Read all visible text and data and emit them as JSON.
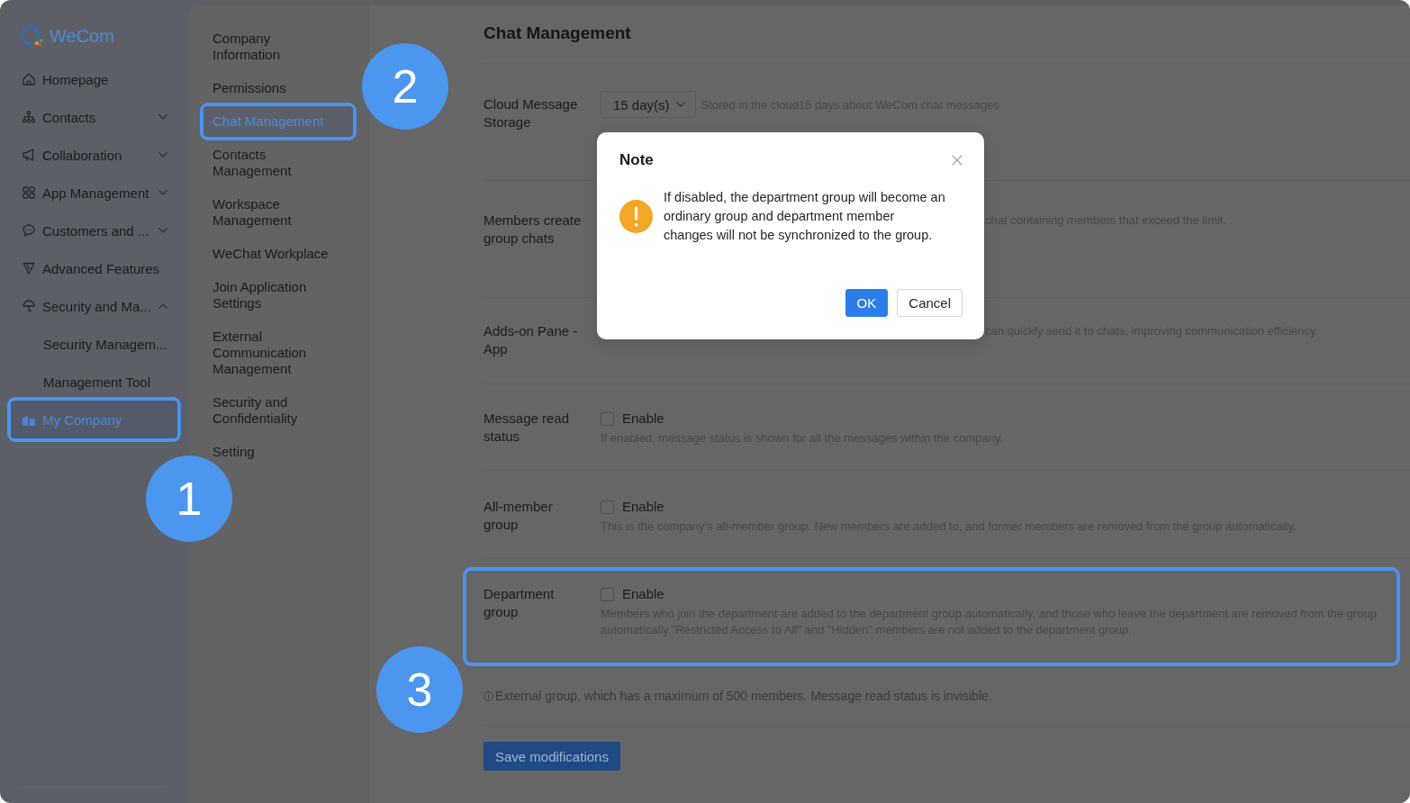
{
  "brand": {
    "name": "WeCom"
  },
  "sidebar": {
    "items": [
      {
        "label": "Homepage",
        "selected": false,
        "highlighted": false
      },
      {
        "label": "Contacts",
        "selected": false,
        "expanded": false,
        "highlighted": false
      },
      {
        "label": "Collaboration",
        "selected": false,
        "expanded": false,
        "highlighted": false
      },
      {
        "label": "App Management",
        "selected": false,
        "expanded": false,
        "highlighted": false
      },
      {
        "label": "Customers and ...",
        "selected": false,
        "expanded": false,
        "highlighted": false
      },
      {
        "label": "Advanced Features",
        "selected": false,
        "highlighted": false
      },
      {
        "label": "Security and Ma...",
        "selected": false,
        "expanded": true,
        "highlighted": false,
        "children": [
          {
            "label": "Security Managem...",
            "selected": false,
            "highlighted": false
          },
          {
            "label": "Management Tool",
            "selected": false,
            "highlighted": false
          }
        ]
      },
      {
        "label": "My Company",
        "selected": true,
        "highlighted": true
      }
    ]
  },
  "subnav": {
    "items": [
      {
        "label": "Company Information",
        "selected": false,
        "highlighted": false
      },
      {
        "label": "Permissions",
        "selected": false,
        "highlighted": false
      },
      {
        "label": "Chat Management",
        "selected": true,
        "highlighted": true
      },
      {
        "label": "Contacts Management",
        "selected": false,
        "highlighted": false
      },
      {
        "label": "Workspace Management",
        "selected": false,
        "highlighted": false
      },
      {
        "label": "WeChat Workplace",
        "selected": false,
        "highlighted": false
      },
      {
        "label": "Join Application Settings",
        "selected": false,
        "highlighted": false
      },
      {
        "label": "External Communication Management",
        "selected": false,
        "highlighted": false
      },
      {
        "label": "Security and Confidentiality",
        "selected": false,
        "highlighted": false
      },
      {
        "label": "Setting",
        "selected": false,
        "highlighted": false
      }
    ]
  },
  "main": {
    "title": "Chat Management",
    "rows": [
      {
        "kind": "select",
        "label": "Cloud Message Storage",
        "value": "15 day(s)",
        "description": "Stored in the cloud15 days about WeCom chat messages",
        "highlighted": false
      },
      {
        "kind": "fragment",
        "label": "Members create group chats",
        "description": "chat containing members that exceed the limit.",
        "highlighted": false
      },
      {
        "kind": "fragment",
        "label": "Adds-on Pane - App",
        "description": "can quickly send it to chats, improving communication efficiency.",
        "highlighted": false
      },
      {
        "kind": "checkbox",
        "label": "Message read status",
        "option": "Enable",
        "checked": false,
        "description": "If enabled, message status is shown for all the messages within the company.",
        "highlighted": false
      },
      {
        "kind": "checkbox",
        "label": "All-member group",
        "option": "Enable",
        "checked": false,
        "description": "This is the company’s all-member group. New members are added to, and former members are removed from the group automatically.",
        "highlighted": false
      },
      {
        "kind": "checkbox",
        "label": "Department group",
        "option": "Enable",
        "checked": false,
        "description": "Members who join the department are added to the department group automatically, and those who leave the department are removed from the group automatically.\"Restricted Access to All\" and \"Hidden\" members are not added to the department group.",
        "highlighted": true
      }
    ],
    "note": "External group, which has a maximum of 500 members. Message read status is invisible.",
    "save_button": "Save modifications"
  },
  "dialog": {
    "title": "Note",
    "message": "If disabled, the department group will become an ordinary group and department member changes will not be synchronized to the group.",
    "buttons": [
      {
        "label": "OK",
        "kind": "primary"
      },
      {
        "label": "Cancel",
        "kind": "default"
      }
    ]
  },
  "annotations": [
    {
      "number": "1"
    },
    {
      "number": "2"
    },
    {
      "number": "3"
    }
  ]
}
